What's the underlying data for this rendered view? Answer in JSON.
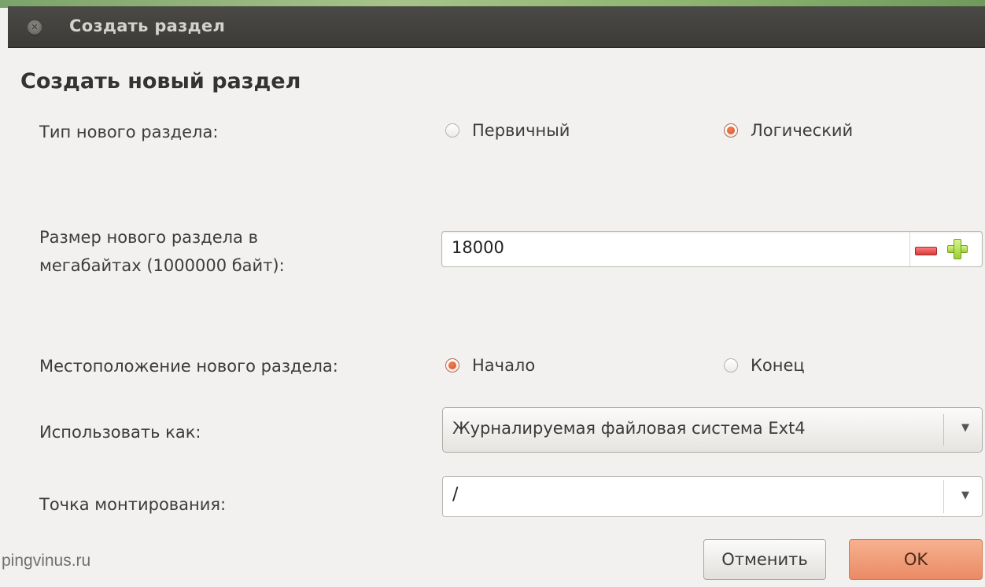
{
  "window": {
    "title": "Создать раздел",
    "heading": "Создать новый раздел"
  },
  "icons": {
    "close": "close-icon",
    "minus": "minus-icon",
    "plus": "plus-icon",
    "dropdown": "chevron-down-icon"
  },
  "colors": {
    "accent": "#e05a2b",
    "ok_button": "#ef9670",
    "titlebar": "#3c3b37"
  },
  "form": {
    "partition_type": {
      "label": "Тип нового раздела:",
      "options": [
        {
          "label": "Первичный",
          "selected": false
        },
        {
          "label": "Логический",
          "selected": true
        }
      ]
    },
    "size": {
      "label_line1": "Размер нового раздела в",
      "label_line2": "мегабайтах (1000000 байт):",
      "value": "18000"
    },
    "location": {
      "label": "Местоположение нового раздела:",
      "options": [
        {
          "label": "Начало",
          "selected": true
        },
        {
          "label": "Конец",
          "selected": false
        }
      ]
    },
    "use_as": {
      "label": "Использовать как:",
      "value": "Журналируемая файловая система Ext4"
    },
    "mount_point": {
      "label": "Точка монтирования:",
      "value": "/"
    }
  },
  "buttons": {
    "cancel": "Отменить",
    "ok": "OK"
  },
  "watermark": "pingvinus.ru"
}
